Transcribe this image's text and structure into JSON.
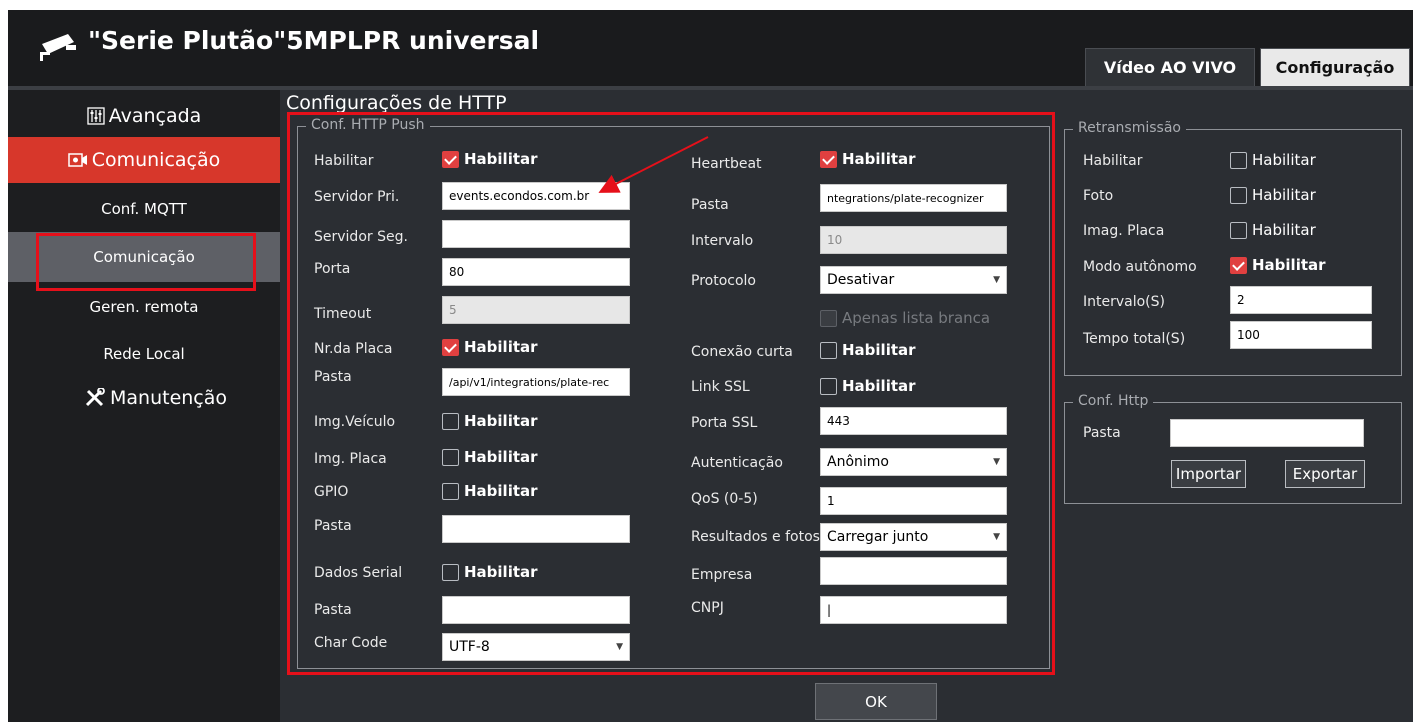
{
  "header": {
    "title": "\"Serie Plutão\"5MPLPR universal",
    "tabs": [
      {
        "label": "Vídeo AO VIVO",
        "active": false
      },
      {
        "label": "Configuração",
        "active": true
      }
    ]
  },
  "sidebar": {
    "items": [
      {
        "label": "Avançada",
        "icon": "sliders-icon",
        "level": "top"
      },
      {
        "label": "Comunicação",
        "icon": "camera-icon",
        "level": "top",
        "active": true
      },
      {
        "label": "Conf. MQTT",
        "level": "sub"
      },
      {
        "label": "Comunicação",
        "level": "sub",
        "selected": true
      },
      {
        "label": "Geren. remota",
        "level": "sub"
      },
      {
        "label": "Rede Local",
        "level": "sub"
      },
      {
        "label": "Manutenção",
        "icon": "tools-icon",
        "level": "top"
      }
    ]
  },
  "page_title": "Configurações de HTTP",
  "http_push": {
    "legend": "Conf. HTTP Push",
    "habilitar": {
      "label": "Habilitar",
      "checkbox_label": "Habilitar",
      "checked": true
    },
    "servidor_pri": {
      "label": "Servidor Pri.",
      "value": "events.econdos.com.br"
    },
    "servidor_seg": {
      "label": "Servidor Seg.",
      "value": ""
    },
    "porta": {
      "label": "Porta",
      "value": "80"
    },
    "timeout": {
      "label": "Timeout",
      "value": "5"
    },
    "nr_placa": {
      "label": "Nr.da Placa",
      "checkbox_label": "Habilitar",
      "checked": true
    },
    "pasta1": {
      "label": "Pasta",
      "value": "/api/v1/integrations/plate-rec"
    },
    "img_veiculo": {
      "label": "Img.Veículo",
      "checkbox_label": "Habilitar",
      "checked": false
    },
    "img_placa": {
      "label": "Img. Placa",
      "checkbox_label": "Habilitar",
      "checked": false
    },
    "gpio": {
      "label": "GPIO",
      "checkbox_label": "Habilitar",
      "checked": false
    },
    "pasta2": {
      "label": "Pasta",
      "value": ""
    },
    "dados_serial": {
      "label": "Dados Serial",
      "checkbox_label": "Habilitar",
      "checked": false
    },
    "pasta3": {
      "label": "Pasta",
      "value": ""
    },
    "char_code": {
      "label": "Char Code",
      "value": "UTF-8"
    },
    "heartbeat": {
      "label": "Heartbeat",
      "checkbox_label": "Habilitar",
      "checked": true
    },
    "hb_pasta": {
      "label": "Pasta",
      "value": "ntegrations/plate-recognizer"
    },
    "intervalo": {
      "label": "Intervalo",
      "value": "10"
    },
    "protocolo": {
      "label": "Protocolo",
      "value": "Desativar"
    },
    "apenas_lista": {
      "label": "Apenas lista branca",
      "checked": false,
      "disabled": true
    },
    "conexao_curta": {
      "label": "Conexão curta",
      "checkbox_label": "Habilitar",
      "checked": false
    },
    "link_ssl": {
      "label": "Link SSL",
      "checkbox_label": "Habilitar",
      "checked": false
    },
    "porta_ssl": {
      "label": "Porta SSL",
      "value": "443"
    },
    "autenticacao": {
      "label": "Autenticação",
      "value": "Anônimo"
    },
    "qos": {
      "label": "QoS (0-5)",
      "value": "1"
    },
    "resultados": {
      "label": "Resultados e fotos",
      "value": "Carregar junto"
    },
    "empresa": {
      "label": "Empresa",
      "value": ""
    },
    "cnpj": {
      "label": "CNPJ",
      "value": "|"
    }
  },
  "retransmissao": {
    "legend": "Retransmissão",
    "habilitar": {
      "label": "Habilitar",
      "checkbox_label": "Habilitar",
      "checked": false
    },
    "foto": {
      "label": "Foto",
      "checkbox_label": "Habilitar",
      "checked": false
    },
    "imag_placa": {
      "label": "Imag. Placa",
      "checkbox_label": "Habilitar",
      "checked": false
    },
    "modo_autonomo": {
      "label": "Modo autônomo",
      "checkbox_label": "Habilitar",
      "checked": true
    },
    "intervalo": {
      "label": "Intervalo(S)",
      "value": "2"
    },
    "tempo_total": {
      "label": "Tempo total(S)",
      "value": "100"
    }
  },
  "conf_http": {
    "legend": "Conf. Http",
    "pasta": {
      "label": "Pasta",
      "value": ""
    },
    "importar": "Importar",
    "exportar": "Exportar"
  },
  "ok_label": "OK",
  "colors": {
    "accent_red": "#d7372b",
    "highlight_red": "#e6101a",
    "checkbox_checked": "#e04040"
  }
}
